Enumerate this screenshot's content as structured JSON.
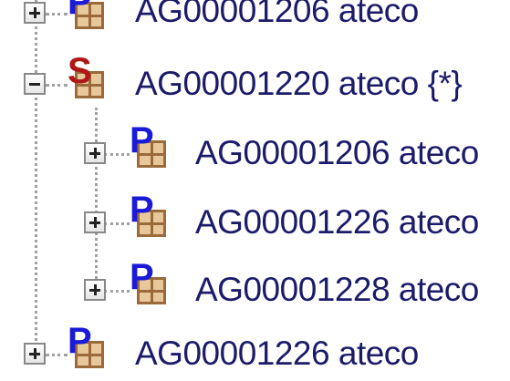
{
  "tree": {
    "nodes": [
      {
        "code": "AG00001206",
        "suffix": "ateco",
        "icon": "P",
        "expander": "plus"
      },
      {
        "code": "AG00001220",
        "suffix": "ateco {*}",
        "icon": "S",
        "expander": "minus"
      },
      {
        "code": "AG00001206",
        "suffix": "ateco",
        "icon": "P",
        "expander": "plus"
      },
      {
        "code": "AG00001226",
        "suffix": "ateco",
        "icon": "P",
        "expander": "plus"
      },
      {
        "code": "AG00001228",
        "suffix": "ateco",
        "icon": "P",
        "expander": "plus"
      },
      {
        "code": "AG00001226",
        "suffix": "ateco",
        "icon": "P",
        "expander": "plus"
      }
    ]
  },
  "colors": {
    "badge_p": "#1a1ad8",
    "badge_s": "#b01818",
    "label": "#1b1b6a",
    "tile": "#e8c79a",
    "tile_border": "#9a6a3a"
  }
}
